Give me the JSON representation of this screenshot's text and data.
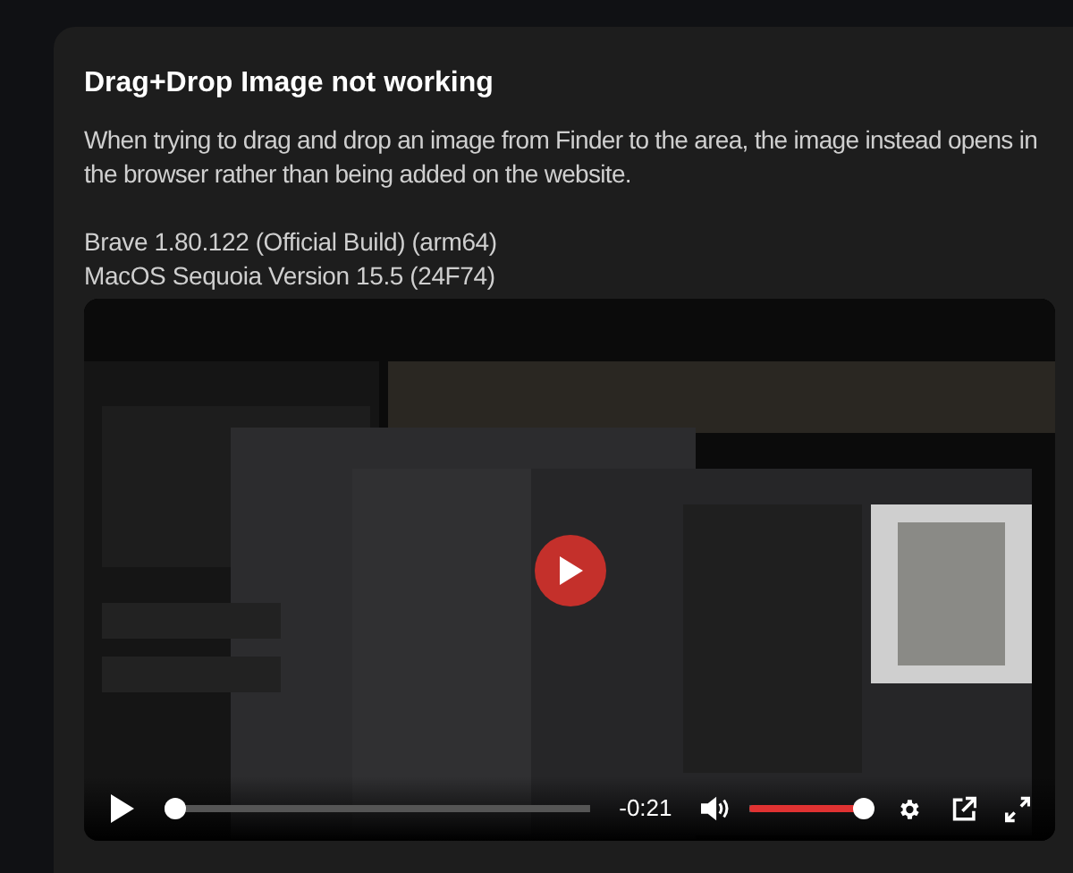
{
  "dialog": {
    "title": "Drag+Drop Image not working",
    "description": "When trying to drag and drop an image from Finder to the area, the image instead opens in the browser rather than being added on the website.",
    "environment": [
      "Brave 1.80.122 (Official Build) (arm64)",
      "MacOS Sequoia Version 15.5 (24F74)"
    ]
  },
  "video": {
    "kind": "picture",
    "playing": false,
    "progress": {
      "level": 0
    },
    "time": "-0:21",
    "volume": {
      "level": 0.96
    }
  }
}
